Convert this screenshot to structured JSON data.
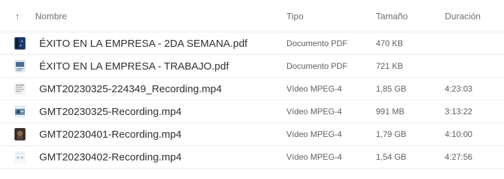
{
  "header": {
    "name_label": "Nombre",
    "type_label": "Tipo",
    "size_label": "Tamaño",
    "duration_label": "Duración",
    "sort_icon": "arrow-up-icon"
  },
  "files": [
    {
      "name": "ÉXITO EN LA EMPRESA - 2DA SEMANA.pdf",
      "type": "Documento PDF",
      "size": "470 KB",
      "duration": "",
      "thumb_color": "#1f3a6b"
    },
    {
      "name": "ÉXITO EN LA EMPRESA - TRABAJO.pdf",
      "type": "Documento PDF",
      "size": "721 KB",
      "duration": "",
      "thumb_color": "#4a6e96"
    },
    {
      "name": "GMT20230325-224349_Recording.mp4",
      "type": "Vídeo MPEG-4",
      "size": "1,85 GB",
      "duration": "4:23:03",
      "thumb_color": "#c9c9c9"
    },
    {
      "name": "GMT20230325-Recording.mp4",
      "type": "Vídeo MPEG-4",
      "size": "991 MB",
      "duration": "3:13:22",
      "thumb_color": "#6a8fae"
    },
    {
      "name": "GMT20230401-Recording.mp4",
      "type": "Vídeo MPEG-4",
      "size": "1,79 GB",
      "duration": "4:10:00",
      "thumb_color": "#3a2f28"
    },
    {
      "name": "GMT20230402-Recording.mp4",
      "type": "Vídeo MPEG-4",
      "size": "1,54 GB",
      "duration": "4:27:56",
      "thumb_color": "#b7d3e4"
    }
  ]
}
